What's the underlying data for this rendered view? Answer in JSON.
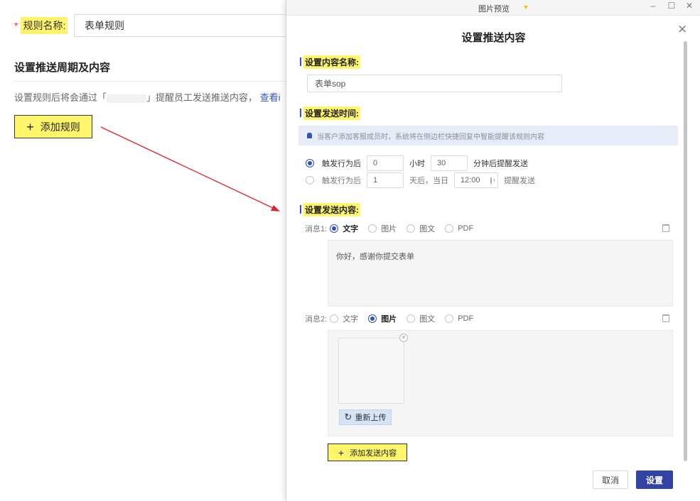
{
  "rule_form": {
    "required_mark": "*",
    "name_label": "规则名称:",
    "name_value": "表单规则",
    "section_title": "设置推送周期及内容",
    "desc_prefix": "设置规则后将会通过「",
    "desc_suffix": "」提醒员工发送推送内容，",
    "desc_link": "查看i",
    "add_rule_label": "添加规则"
  },
  "preview_window": {
    "title": "图片预览",
    "controls": [
      "–",
      "☐",
      "✕"
    ]
  },
  "dialog": {
    "title": "设置推送内容",
    "content_name": {
      "label": "设置内容名称:",
      "value": "表单sop"
    },
    "send_time": {
      "label": "设置发送时间:",
      "notice": "当客户添加客服成员时，系统将在侧边栏快捷回复中智能提醒该规则内容",
      "option1": {
        "prefix": "触发行为后",
        "hours": "0",
        "hours_unit": "小时",
        "minutes": "30",
        "suffix": "分钟后提醒发送",
        "selected": true
      },
      "option2": {
        "prefix": "触发行为后",
        "days": "1",
        "days_unit": "天后，当日",
        "time": "12:00",
        "suffix": "提醒发送",
        "selected": false
      }
    },
    "send_content": {
      "label": "设置发送内容:",
      "messages": [
        {
          "label": "消息1:",
          "options": [
            "文字",
            "图片",
            "图文",
            "PDF"
          ],
          "selected_index": 0,
          "text": "你好，感谢你提交表单"
        },
        {
          "label": "消息2:",
          "options": [
            "文字",
            "图片",
            "图文",
            "PDF"
          ],
          "selected_index": 1,
          "reupload_label": "重新上传"
        }
      ],
      "add_content_label": "添加发送内容"
    },
    "buttons": {
      "cancel": "取消",
      "confirm": "设置"
    }
  },
  "colors": {
    "highlight": "#fff56a",
    "accent": "#2f54b8",
    "primary_button": "#3343a5",
    "arrow": "#d9262a",
    "required": "#e8332f"
  }
}
